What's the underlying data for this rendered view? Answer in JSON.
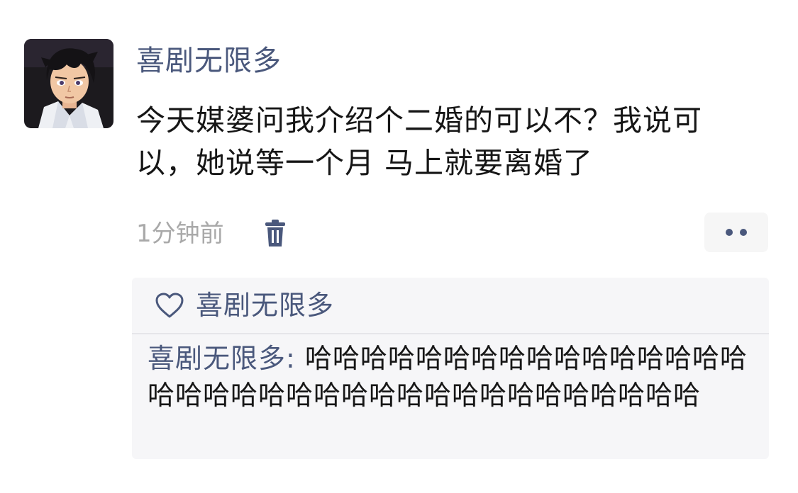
{
  "post": {
    "author": "喜剧无限多",
    "content": "今天媒婆问我介绍个二婚的可以不？我说可以，她说等一个月 马上就要离婚了",
    "time": "1分钟前",
    "icons": {
      "avatar": "anime-avatar",
      "delete": "trash-icon",
      "more": "more-dots-icon"
    }
  },
  "likes": {
    "icon": "heart-icon",
    "names": "喜剧无限多"
  },
  "comment": {
    "author": "喜剧无限多",
    "separator": ": ",
    "text": "哈哈哈哈哈哈哈哈哈哈哈哈哈哈哈哈哈哈哈哈哈哈哈哈哈哈哈哈哈哈哈哈哈哈哈哈"
  },
  "colors": {
    "name_color": "#4a587c",
    "text_color": "#161616",
    "time_color": "#a9a9a9",
    "panel_bg": "#f6f6f8"
  }
}
